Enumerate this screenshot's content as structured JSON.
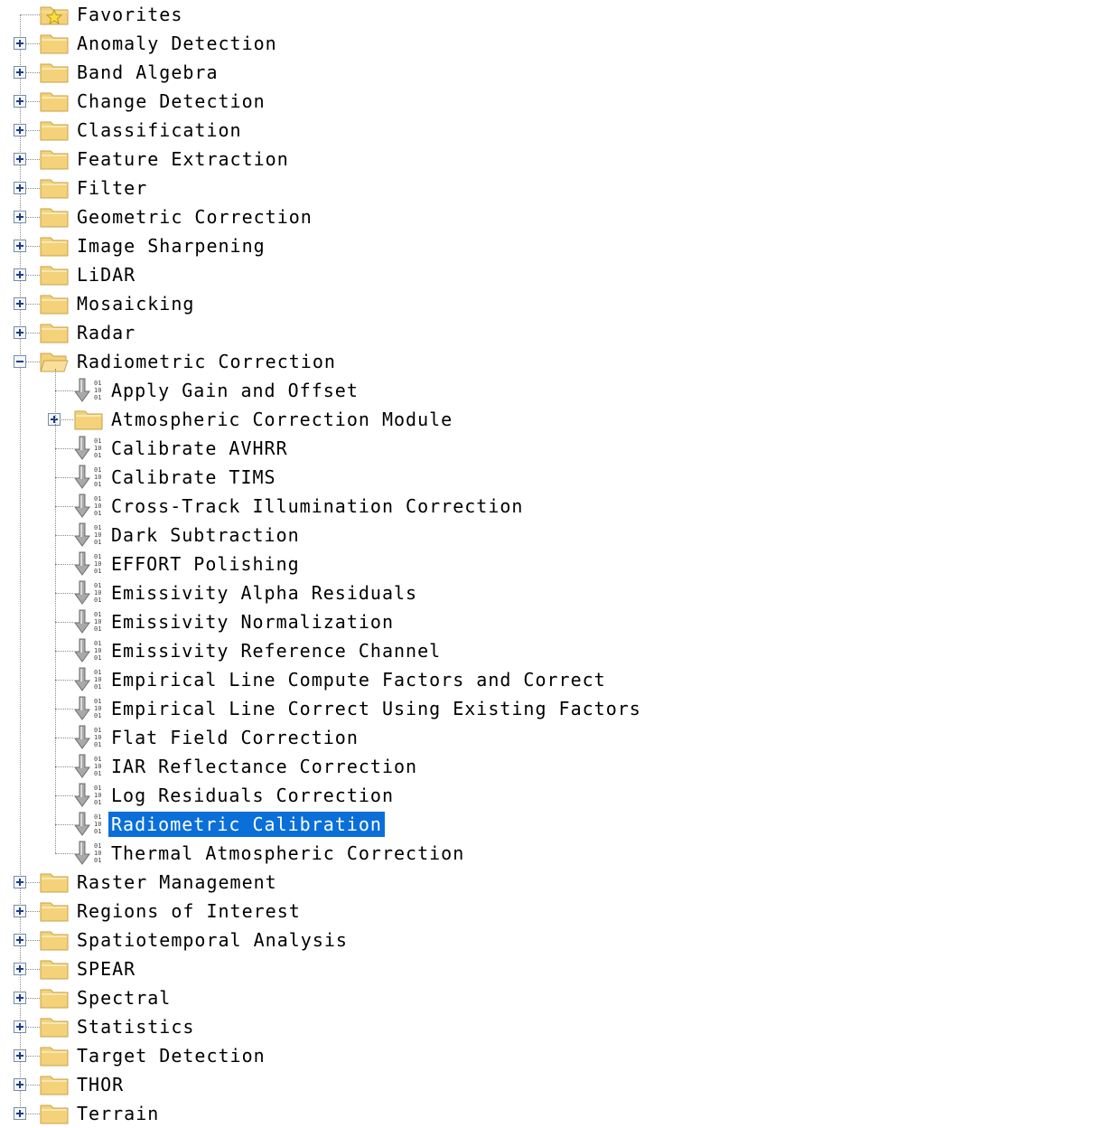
{
  "tree": {
    "favorites": {
      "label": "Favorites",
      "icon": "favorites-folder-icon"
    },
    "categories": [
      {
        "label": "Anomaly Detection",
        "expanded": false
      },
      {
        "label": "Band Algebra",
        "expanded": false
      },
      {
        "label": "Change Detection",
        "expanded": false
      },
      {
        "label": "Classification",
        "expanded": false
      },
      {
        "label": "Feature Extraction",
        "expanded": false
      },
      {
        "label": "Filter",
        "expanded": false
      },
      {
        "label": "Geometric Correction",
        "expanded": false
      },
      {
        "label": "Image Sharpening",
        "expanded": false
      },
      {
        "label": "LiDAR",
        "expanded": false
      },
      {
        "label": "Mosaicking",
        "expanded": false
      },
      {
        "label": "Radar",
        "expanded": false
      },
      {
        "label": "Radiometric Correction",
        "expanded": true
      },
      {
        "label": "Raster Management",
        "expanded": false
      },
      {
        "label": "Regions of Interest",
        "expanded": false
      },
      {
        "label": "Spatiotemporal Analysis",
        "expanded": false
      },
      {
        "label": "SPEAR",
        "expanded": false
      },
      {
        "label": "Spectral",
        "expanded": false
      },
      {
        "label": "Statistics",
        "expanded": false
      },
      {
        "label": "Target Detection",
        "expanded": false
      },
      {
        "label": "THOR",
        "expanded": false
      },
      {
        "label": "Terrain",
        "expanded": false
      }
    ],
    "radiometric_children": [
      {
        "label": "Apply Gain and Offset",
        "kind": "tool"
      },
      {
        "label": "Atmospheric Correction Module",
        "kind": "folder"
      },
      {
        "label": "Calibrate AVHRR",
        "kind": "tool"
      },
      {
        "label": "Calibrate TIMS",
        "kind": "tool"
      },
      {
        "label": "Cross-Track Illumination Correction",
        "kind": "tool"
      },
      {
        "label": "Dark Subtraction",
        "kind": "tool"
      },
      {
        "label": "EFFORT Polishing",
        "kind": "tool"
      },
      {
        "label": "Emissivity Alpha Residuals",
        "kind": "tool"
      },
      {
        "label": "Emissivity Normalization",
        "kind": "tool"
      },
      {
        "label": "Emissivity Reference Channel",
        "kind": "tool"
      },
      {
        "label": "Empirical Line Compute Factors and Correct",
        "kind": "tool"
      },
      {
        "label": "Empirical Line Correct Using Existing Factors",
        "kind": "tool"
      },
      {
        "label": "Flat Field Correction",
        "kind": "tool"
      },
      {
        "label": "IAR Reflectance Correction",
        "kind": "tool"
      },
      {
        "label": "Log Residuals Correction",
        "kind": "tool"
      },
      {
        "label": "Radiometric Calibration",
        "kind": "tool",
        "selected": true
      },
      {
        "label": "Thermal Atmospheric Correction",
        "kind": "tool"
      }
    ],
    "colors": {
      "selection": "#0a6fd8",
      "folder": "#f3d27a",
      "folder_edge": "#c9a14a",
      "expander": "#1b3d8a"
    }
  }
}
